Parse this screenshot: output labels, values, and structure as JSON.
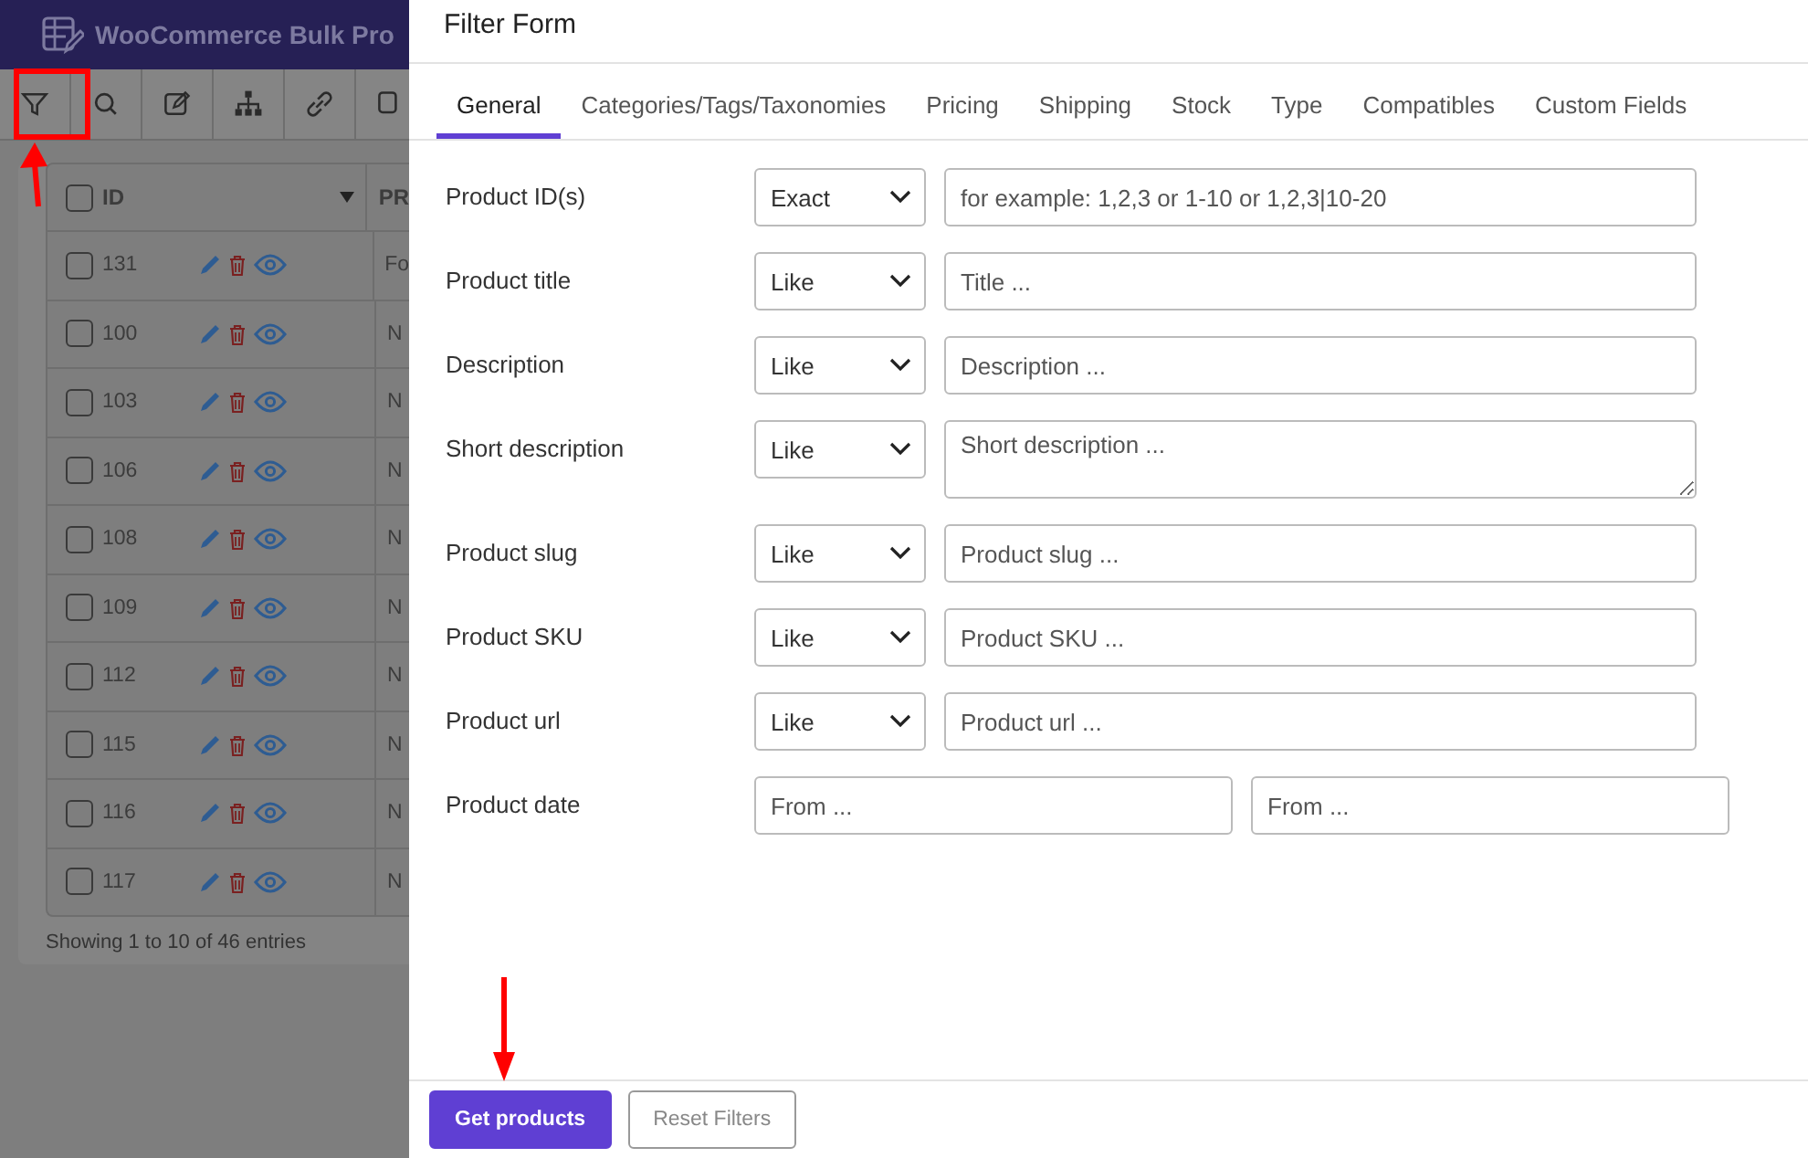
{
  "app": {
    "title": "WooCommerce Bulk Pro",
    "toolbar": [
      {
        "kind": "filter"
      },
      {
        "kind": "search"
      },
      {
        "kind": "edit"
      },
      {
        "kind": "tree"
      },
      {
        "kind": "link"
      },
      {
        "kind": "copy"
      }
    ],
    "table": {
      "columns": [
        "ID",
        "PR"
      ],
      "header_checked": false,
      "rows": [
        {
          "id": "131",
          "checked": false,
          "column_2": "Fo"
        },
        {
          "id": "100",
          "checked": false,
          "column_2": "N"
        },
        {
          "id": "103",
          "checked": false,
          "column_2": "N"
        },
        {
          "id": "106",
          "checked": false,
          "column_2": "N"
        },
        {
          "id": "108",
          "checked": false,
          "column_2": "N"
        },
        {
          "id": "109",
          "checked": false,
          "column_2": "N"
        },
        {
          "id": "112",
          "checked": false,
          "column_2": "N"
        },
        {
          "id": "115",
          "checked": false,
          "column_2": "N"
        },
        {
          "id": "116",
          "checked": false,
          "column_2": "N"
        },
        {
          "id": "117",
          "checked": false,
          "column_2": "N"
        }
      ],
      "footer": "Showing 1 to 10 of 46 entries"
    }
  },
  "filter_form": {
    "title": "Filter Form",
    "tabs": [
      {
        "label": "General",
        "selected": true
      },
      {
        "label": "Categories/Tags/Taxonomies",
        "selected": false
      },
      {
        "label": "Pricing",
        "selected": false
      },
      {
        "label": "Shipping",
        "selected": false
      },
      {
        "label": "Stock",
        "selected": false
      },
      {
        "label": "Type",
        "selected": false
      },
      {
        "label": "Compatibles",
        "selected": false
      },
      {
        "label": "Custom Fields",
        "selected": false
      }
    ],
    "fields": [
      {
        "kind": "text",
        "label": "Product ID(s)",
        "operator": "Exact",
        "placeholder": "for example: 1,2,3 or 1-10 or 1,2,3|10-20"
      },
      {
        "kind": "text",
        "label": "Product title",
        "operator": "Like",
        "placeholder": "Title ..."
      },
      {
        "kind": "text",
        "label": "Description",
        "operator": "Like",
        "placeholder": "Description ..."
      },
      {
        "kind": "textarea",
        "label": "Short description",
        "operator": "Like",
        "placeholder": "Short description ..."
      },
      {
        "kind": "text",
        "label": "Product slug",
        "operator": "Like",
        "placeholder": "Product slug ..."
      },
      {
        "kind": "text",
        "label": "Product SKU",
        "operator": "Like",
        "placeholder": "Product SKU ..."
      },
      {
        "kind": "text",
        "label": "Product url",
        "operator": "Like",
        "placeholder": "Product url ..."
      },
      {
        "kind": "range",
        "label": "Product date",
        "from_placeholder": "From ...",
        "to_placeholder": "From ..."
      }
    ],
    "buttons": [
      {
        "kind": "primary",
        "label": "Get products"
      },
      {
        "kind": "secondary",
        "label": "Reset Filters"
      }
    ]
  }
}
